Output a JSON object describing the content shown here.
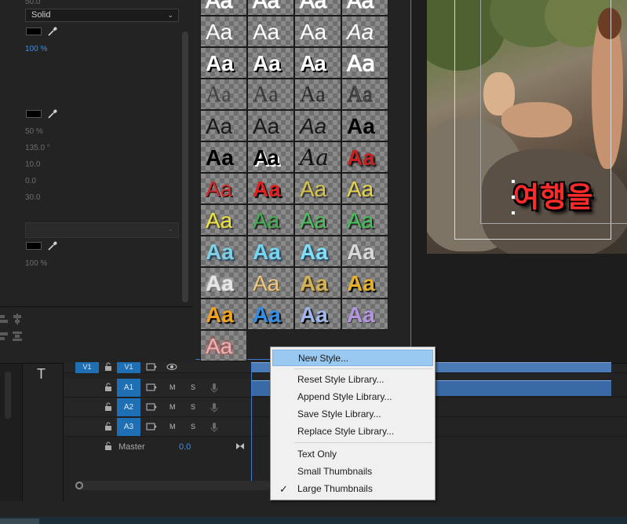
{
  "effect_controls": {
    "top_value": "50.0",
    "fill_type": "Solid",
    "fill_opacity": "100 %",
    "shadow_opacity": "50 %",
    "shadow_angle": "135.0 °",
    "shadow_distance": "10.0",
    "shadow_size": "0.0",
    "shadow_blur": "30.0",
    "bg_opacity": "100 %"
  },
  "styles_grid": {
    "cells": [
      {
        "label": "Aa",
        "color": "#ffffff",
        "style": "outline"
      },
      {
        "label": "Aa",
        "color": "#ffffff",
        "style": "outline"
      },
      {
        "label": "Aa",
        "color": "#ffffff",
        "style": "outline"
      },
      {
        "label": "Aa",
        "color": "#ffffff",
        "style": "outline"
      },
      {
        "label": "Aa",
        "color": "#ffffff",
        "style": "plain"
      },
      {
        "label": "Aa",
        "color": "#ffffff",
        "style": "plain"
      },
      {
        "label": "Aa",
        "color": "#ffffff",
        "style": "plain"
      },
      {
        "label": "Aa",
        "color": "#ffffff",
        "style": "italic"
      },
      {
        "label": "Aa",
        "color": "#ffffff",
        "style": "shadow"
      },
      {
        "label": "Aa",
        "color": "#ffffff",
        "style": "bold-shadow"
      },
      {
        "label": "Aa",
        "color": "#ffffff",
        "style": "condensed"
      },
      {
        "label": "Aa",
        "color": "#ffffff",
        "style": "thin"
      },
      {
        "label": "Aa",
        "color": "#444444",
        "style": "serif"
      },
      {
        "label": "Aa",
        "color": "#3a3a3a",
        "style": "serif"
      },
      {
        "label": "Aa",
        "color": "#2a2a2a",
        "style": "serif"
      },
      {
        "label": "Aa",
        "color": "#555555",
        "style": "outline-dark"
      },
      {
        "label": "Aa",
        "color": "#1a1a1a",
        "style": "plain"
      },
      {
        "label": "Aa",
        "color": "#1a1a1a",
        "style": "plain"
      },
      {
        "label": "Aa",
        "color": "#1a1a1a",
        "style": "italic"
      },
      {
        "label": "Aa",
        "color": "#000000",
        "style": "bold"
      },
      {
        "label": "Aa",
        "color": "#000000",
        "style": "bold"
      },
      {
        "label": "Aa",
        "color": "#000000",
        "style": "condensed-bold"
      },
      {
        "label": "Aa",
        "color": "#111111",
        "style": "script"
      },
      {
        "label": "Aa",
        "color": "#c82020",
        "style": "red-shadow"
      },
      {
        "label": "Aa",
        "color": "#d62b2b",
        "style": "red"
      },
      {
        "label": "Aa",
        "color": "#e21f1f",
        "style": "red-bold"
      },
      {
        "label": "Aa",
        "color": "#d7c44a",
        "style": "yellow"
      },
      {
        "label": "Aa",
        "color": "#e6d34c",
        "style": "yellow"
      },
      {
        "label": "Aa",
        "color": "#f0e23a",
        "style": "yellow"
      },
      {
        "label": "Aa",
        "color": "#3fae4c",
        "style": "green"
      },
      {
        "label": "Aa",
        "color": "#4cbf5a",
        "style": "green"
      },
      {
        "label": "Aa",
        "color": "#41c255",
        "style": "green"
      },
      {
        "label": "Aa",
        "color": "#7fd0e2",
        "style": "cyan"
      },
      {
        "label": "Aa",
        "color": "#76d6f1",
        "style": "cyan"
      },
      {
        "label": "Aa",
        "color": "#7fe0f7",
        "style": "cyan"
      },
      {
        "label": "Aa",
        "color": "#d8d8d8",
        "style": "silver"
      },
      {
        "label": "Aa",
        "color": "#e6e6e6",
        "style": "chrome"
      },
      {
        "label": "Aa",
        "color": "#e9c88a",
        "style": "gold-light"
      },
      {
        "label": "Aa",
        "color": "#d3b35a",
        "style": "gold"
      },
      {
        "label": "Aa",
        "color": "#e6b128",
        "style": "gold-bold"
      },
      {
        "label": "Aa",
        "color": "#f2a11c",
        "style": "orange-grad"
      },
      {
        "label": "Aa",
        "color": "#2f8fe8",
        "style": "blue-grad"
      },
      {
        "label": "Aa",
        "color": "#9fb6ec",
        "style": "lavender"
      },
      {
        "label": "Aa",
        "color": "#b495e0",
        "style": "purple"
      },
      {
        "label": "Aa",
        "color": "#f3b0b0",
        "style": "pink-glow"
      }
    ]
  },
  "monitor": {
    "title_text": "여행을"
  },
  "timeline": {
    "tracks": [
      {
        "id": "V1",
        "source": "V1"
      },
      {
        "id": "A1"
      },
      {
        "id": "A2"
      },
      {
        "id": "A3"
      }
    ],
    "mute_label": "M",
    "solo_label": "S",
    "master_label": "Master",
    "master_value": "0.0",
    "type_tool": "T"
  },
  "context_menu": {
    "items": [
      {
        "label": "New Style...",
        "highlighted": true,
        "checked": false
      },
      {
        "label": "Reset Style Library...",
        "highlighted": false,
        "checked": false
      },
      {
        "label": "Append Style Library...",
        "highlighted": false,
        "checked": false
      },
      {
        "label": "Save Style Library...",
        "highlighted": false,
        "checked": false
      },
      {
        "label": "Replace Style Library...",
        "highlighted": false,
        "checked": false
      },
      {
        "label": "Text Only",
        "highlighted": false,
        "checked": false
      },
      {
        "label": "Small Thumbnails",
        "highlighted": false,
        "checked": false
      },
      {
        "label": "Large Thumbnails",
        "highlighted": false,
        "checked": true
      }
    ],
    "check_glyph": "✓"
  },
  "colors": {
    "accent_blue": "#3f8fe0",
    "track_target_blue": "#1f6fb5",
    "menu_highlight": "#99c8f1"
  }
}
